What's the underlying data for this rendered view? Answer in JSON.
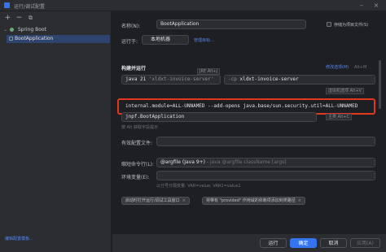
{
  "window": {
    "title": "运行/调试配置"
  },
  "sidebar": {
    "tools": {
      "add": "+",
      "remove": "−",
      "copy": "⧉"
    },
    "tree": {
      "parent_label": "Spring Boot",
      "child_label": "BootApplication"
    },
    "edit_templates": "编辑配置模板..."
  },
  "form": {
    "name_label": "名称(N):",
    "name_value": "BootApplication",
    "store_as_file_label": "存储为项目文件(S)",
    "run_on_label": "运行于:",
    "run_on_value": "本地机器",
    "manage_targets": "管理目标...",
    "run_on_hint": "",
    "build_run_title": "构建并运行",
    "modify_options": "修改选项(M)",
    "modify_options_shortcut": "Alt+M",
    "jre_tag": "JRE Alt+J",
    "jdk_value": "java 21",
    "jdk_detail": "'xldxt-invoice-server'",
    "module_prefix": "-cp",
    "module_value": "xldxt-invoice-server",
    "vm_options_tag": "虚拟机选项 Alt+V",
    "vm_options_value": "internal.module=ALL-UNNAMED --add-opens java.base/sun.security.util=ALL-UNNAMED",
    "main_class_tag": "主类 Alt+C",
    "main_class_value": "jnpf.BootApplication",
    "main_class_hint": "按 Alt 获取字段提示",
    "active_profiles_label": "有效配置文件:",
    "shorten_label": "缩短命令行(L):",
    "shorten_value": "@argfile (Java 9+)",
    "shorten_detail": "- java @argfile className [args]",
    "env_label": "环境变量(E):",
    "env_hint": "以分号分隔变量: VAR=value; VAR1=value1",
    "chip1": "启动时打开运行/调试工具窗口",
    "chip2": "将带有 \"provided\" 作用域的依赖项添加到类路径"
  },
  "buttons": {
    "run": "运行",
    "ok": "确定",
    "cancel": "取消",
    "apply": "应用(A)"
  },
  "colors": {
    "accent": "#3574f0",
    "highlight": "#e0371e",
    "link": "#548af7"
  }
}
